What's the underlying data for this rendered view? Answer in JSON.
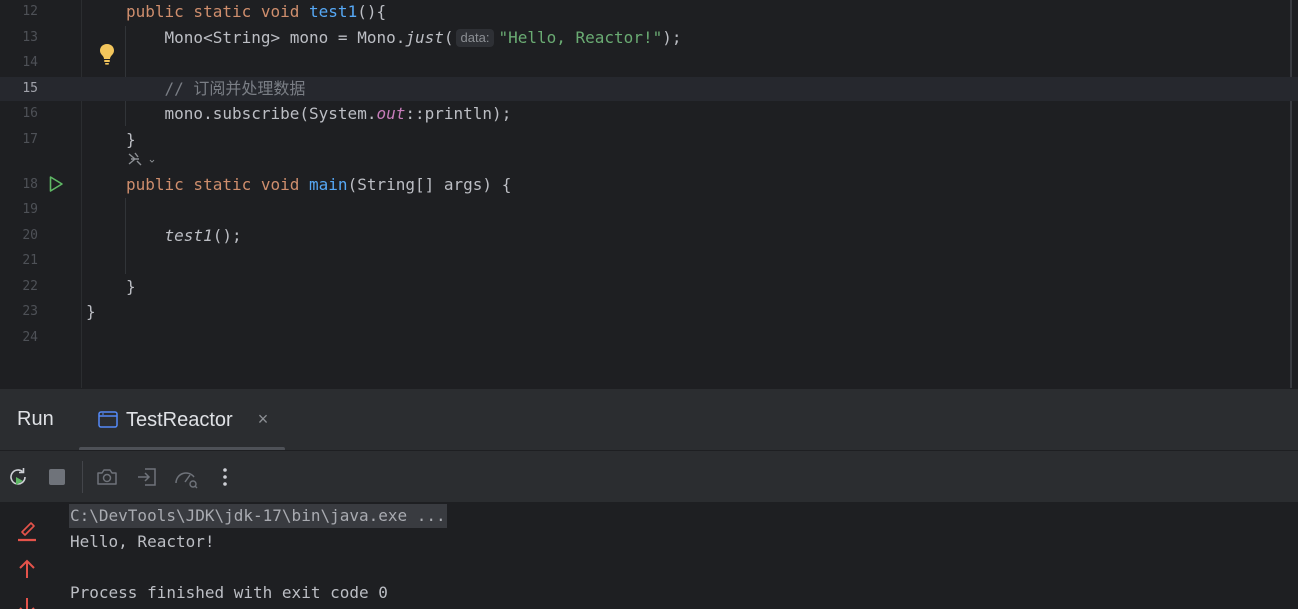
{
  "editor": {
    "lines": [
      {
        "num": "12",
        "tokens": [
          [
            "kw",
            "public static void "
          ],
          [
            "fn",
            "test1"
          ],
          [
            "",
            "(){"
          ]
        ]
      },
      {
        "num": "13",
        "tokens": [
          [
            "",
            "    Mono<String> mono = Mono."
          ],
          [
            "it",
            "just"
          ],
          [
            "",
            "("
          ],
          [
            "hint",
            "data:"
          ],
          [
            "str",
            "\"Hello, Reactor!\""
          ],
          [
            "",
            ");"
          ]
        ]
      },
      {
        "num": "14",
        "tokens": []
      },
      {
        "num": "15",
        "tokens": [
          [
            "cmt",
            "    // 订阅并处理数据"
          ]
        ]
      },
      {
        "num": "16",
        "tokens": [
          [
            "",
            "    mono.subscribe(System."
          ],
          [
            "field",
            "out"
          ],
          [
            "",
            "::println);"
          ]
        ]
      },
      {
        "num": "17",
        "tokens": [
          [
            "",
            "}"
          ]
        ]
      },
      {
        "num": "18",
        "tokens": [
          [
            "kw",
            "public static void "
          ],
          [
            "fn",
            "main"
          ],
          [
            "",
            "(String[] args) {"
          ]
        ]
      },
      {
        "num": "19",
        "tokens": []
      },
      {
        "num": "20",
        "tokens": [
          [
            "",
            "    "
          ],
          [
            "it",
            "test1"
          ],
          [
            "",
            "();"
          ]
        ]
      },
      {
        "num": "21",
        "tokens": []
      },
      {
        "num": "22",
        "tokens": [
          [
            "",
            "}"
          ]
        ]
      },
      {
        "num": "23",
        "tokens": [
          [
            "",
            "}"
          ]
        ]
      },
      {
        "num": "24",
        "tokens": []
      }
    ],
    "current_line": "15",
    "ai_hint_glyph": "⌄"
  },
  "run_panel": {
    "title": "Run",
    "tab_label": "TestReactor",
    "close_glyph": "×"
  },
  "console": {
    "command": "C:\\DevTools\\JDK\\jdk-17\\bin\\java.exe ...",
    "output_line": "Hello, Reactor!",
    "exit_line": "Process finished with exit code 0"
  },
  "icons": {
    "accent_run_green": "#5fb865",
    "bulb_yellow": "#f2c55c",
    "error_red": "#e5534b"
  }
}
